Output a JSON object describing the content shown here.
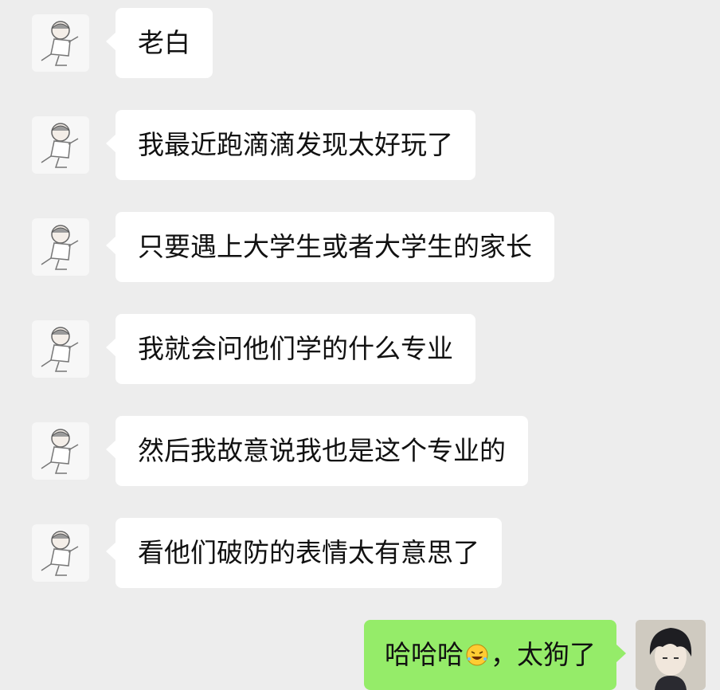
{
  "conversation": {
    "messages": [
      {
        "sender": "friend",
        "text": "老白",
        "avatar_icon": "boy-sitting-sketch-icon"
      },
      {
        "sender": "friend",
        "text": "我最近跑滴滴发现太好玩了",
        "avatar_icon": "boy-sitting-sketch-icon"
      },
      {
        "sender": "friend",
        "text": "只要遇上大学生或者大学生的家长",
        "avatar_icon": "boy-sitting-sketch-icon"
      },
      {
        "sender": "friend",
        "text": "我就会问他们学的什么专业",
        "avatar_icon": "boy-sitting-sketch-icon"
      },
      {
        "sender": "friend",
        "text": "然后我故意说我也是这个专业的",
        "avatar_icon": "boy-sitting-sketch-icon"
      },
      {
        "sender": "friend",
        "text": "看他们破防的表情太有意思了",
        "avatar_icon": "boy-sitting-sketch-icon"
      },
      {
        "sender": "self",
        "text_before_emoji": "哈哈哈",
        "emoji": "rofl-emoji-icon",
        "text_after_emoji": "，太狗了",
        "avatar_icon": "dark-hair-anime-boy-icon"
      }
    ]
  },
  "colors": {
    "background": "#ededed",
    "incoming_bubble": "#ffffff",
    "outgoing_bubble": "#95ec69"
  }
}
